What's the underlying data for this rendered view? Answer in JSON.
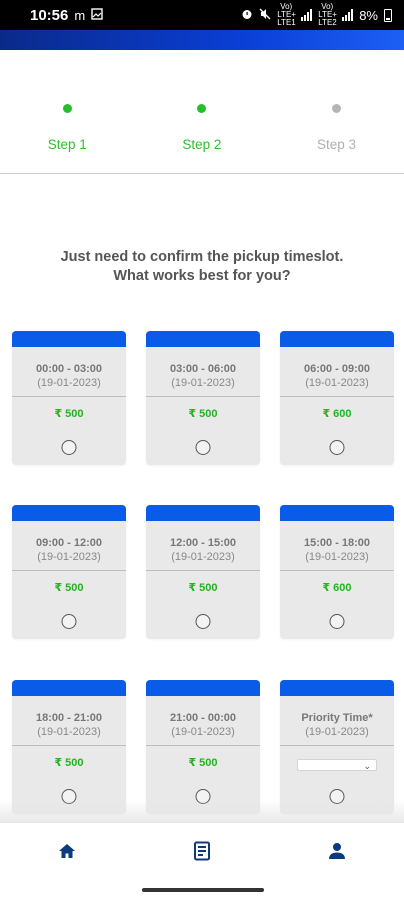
{
  "status_bar": {
    "time": "10:56",
    "carrier_glyph": "m",
    "net1": "Vo) LTE+ LTE1",
    "net2": "Vo) LTE+ LTE2",
    "battery": "8%"
  },
  "steps": [
    {
      "label": "Step 1",
      "active": true
    },
    {
      "label": "Step 2",
      "active": true
    },
    {
      "label": "Step 3",
      "active": false
    }
  ],
  "prompt": {
    "line1": "Just need to confirm the pickup timeslot.",
    "line2": "What works best for you?"
  },
  "slots": [
    {
      "time": "00:00 - 03:00",
      "date": "(19-01-2023)",
      "price": "₹ 500"
    },
    {
      "time": "03:00 - 06:00",
      "date": "(19-01-2023)",
      "price": "₹ 500"
    },
    {
      "time": "06:00 - 09:00",
      "date": "(19-01-2023)",
      "price": "₹ 600"
    },
    {
      "time": "09:00 - 12:00",
      "date": "(19-01-2023)",
      "price": "₹ 500"
    },
    {
      "time": "12:00 - 15:00",
      "date": "(19-01-2023)",
      "price": "₹ 500"
    },
    {
      "time": "15:00 - 18:00",
      "date": "(19-01-2023)",
      "price": "₹ 600"
    },
    {
      "time": "18:00 - 21:00",
      "date": "(19-01-2023)",
      "price": "₹ 500"
    },
    {
      "time": "21:00 - 00:00",
      "date": "(19-01-2023)",
      "price": "₹ 500"
    },
    {
      "time": "Priority Time*",
      "date": "(19-01-2023)",
      "price": ""
    }
  ],
  "colors": {
    "accent_blue": "#0a5be8",
    "active_green": "#2fbf2a",
    "inactive_grey": "#b0b0b0"
  },
  "bottom_nav": {
    "items": [
      "home-icon",
      "receipt-icon",
      "profile-icon"
    ]
  }
}
